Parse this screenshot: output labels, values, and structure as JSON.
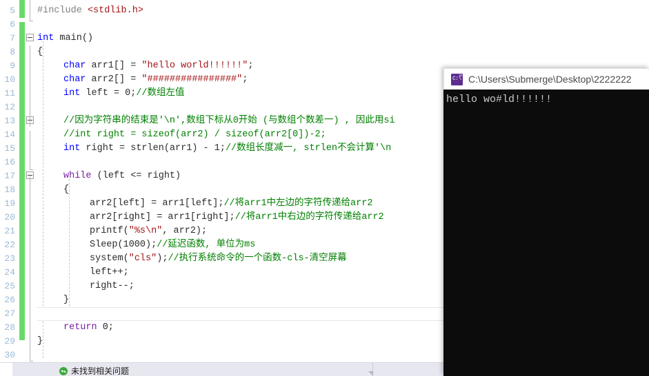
{
  "editor": {
    "first_visible_line_number": 5,
    "line_numbers": [
      5,
      6,
      7,
      8,
      9,
      10,
      11,
      12,
      13,
      14,
      15,
      16,
      17,
      18,
      19,
      20,
      21,
      22,
      23,
      24,
      25,
      26,
      27,
      28,
      29,
      30
    ],
    "lines": [
      {
        "n": 5,
        "indent": 0,
        "segments": [
          {
            "t": "#include ",
            "c": "ppd"
          },
          {
            "t": "<stdlib.h>",
            "c": "inc"
          }
        ]
      },
      {
        "n": 6,
        "indent": 0,
        "segments": []
      },
      {
        "n": 7,
        "indent": 0,
        "segments": [
          {
            "t": "int",
            "c": "kw"
          },
          {
            "t": " main()",
            "c": "pln"
          }
        ]
      },
      {
        "n": 8,
        "indent": 0,
        "segments": [
          {
            "t": "{",
            "c": "pln"
          }
        ]
      },
      {
        "n": 9,
        "indent": 1,
        "segments": [
          {
            "t": "char",
            "c": "kw"
          },
          {
            "t": " arr1[] = ",
            "c": "pln"
          },
          {
            "t": "\"hello world!!!!!!\"",
            "c": "str"
          },
          {
            "t": ";",
            "c": "pln"
          }
        ]
      },
      {
        "n": 10,
        "indent": 1,
        "segments": [
          {
            "t": "char",
            "c": "kw"
          },
          {
            "t": " arr2[] = ",
            "c": "pln"
          },
          {
            "t": "\"################\"",
            "c": "str"
          },
          {
            "t": ";",
            "c": "pln"
          }
        ]
      },
      {
        "n": 11,
        "indent": 1,
        "segments": [
          {
            "t": "int",
            "c": "kw"
          },
          {
            "t": " left = 0;",
            "c": "pln"
          },
          {
            "t": "//数组左值",
            "c": "cmt"
          }
        ]
      },
      {
        "n": 12,
        "indent": 1,
        "segments": []
      },
      {
        "n": 13,
        "indent": 1,
        "segments": [
          {
            "t": "//因为字符串的结束是'\\n',数组下标从0开始 (与数组个数差一) , 因此用si",
            "c": "cmt"
          }
        ]
      },
      {
        "n": 14,
        "indent": 1,
        "segments": [
          {
            "t": "//int right = sizeof(arr2) / sizeof(arr2[0])-2;",
            "c": "cmt"
          }
        ]
      },
      {
        "n": 15,
        "indent": 1,
        "segments": [
          {
            "t": "int",
            "c": "kw"
          },
          {
            "t": " right = strlen(arr1) - 1;",
            "c": "pln"
          },
          {
            "t": "//数组长度减一, strlen不会计算'\\n",
            "c": "cmt"
          }
        ]
      },
      {
        "n": 16,
        "indent": 1,
        "segments": []
      },
      {
        "n": 17,
        "indent": 1,
        "segments": [
          {
            "t": "while",
            "c": "kw2"
          },
          {
            "t": " (left <= right)",
            "c": "pln"
          }
        ]
      },
      {
        "n": 18,
        "indent": 1,
        "segments": [
          {
            "t": "{",
            "c": "pln"
          }
        ]
      },
      {
        "n": 19,
        "indent": 2,
        "segments": [
          {
            "t": "arr2[left] = arr1[left];",
            "c": "pln"
          },
          {
            "t": "//将arr1中左边的字符传递给arr2",
            "c": "cmt"
          }
        ]
      },
      {
        "n": 20,
        "indent": 2,
        "segments": [
          {
            "t": "arr2[right] = arr1[right];",
            "c": "pln"
          },
          {
            "t": "//将arr1中右边的字符传递给arr2",
            "c": "cmt"
          }
        ]
      },
      {
        "n": 21,
        "indent": 2,
        "segments": [
          {
            "t": "printf(",
            "c": "pln"
          },
          {
            "t": "\"%s\\n\"",
            "c": "str"
          },
          {
            "t": ", arr2);",
            "c": "pln"
          }
        ]
      },
      {
        "n": 22,
        "indent": 2,
        "segments": [
          {
            "t": "Sleep(1000);",
            "c": "pln"
          },
          {
            "t": "//延迟函数, 单位为ms",
            "c": "cmt"
          }
        ]
      },
      {
        "n": 23,
        "indent": 2,
        "segments": [
          {
            "t": "system(",
            "c": "pln"
          },
          {
            "t": "\"cls\"",
            "c": "str"
          },
          {
            "t": ");",
            "c": "pln"
          },
          {
            "t": "//执行系统命令的一个函数-cls-清空屏幕",
            "c": "cmt"
          }
        ]
      },
      {
        "n": 24,
        "indent": 2,
        "segments": [
          {
            "t": "left++;",
            "c": "pln"
          }
        ]
      },
      {
        "n": 25,
        "indent": 2,
        "segments": [
          {
            "t": "right--;",
            "c": "pln"
          }
        ]
      },
      {
        "n": 26,
        "indent": 1,
        "segments": [
          {
            "t": "}",
            "c": "pln"
          }
        ]
      },
      {
        "n": 27,
        "indent": 1,
        "segments": []
      },
      {
        "n": 28,
        "indent": 1,
        "segments": [
          {
            "t": "return",
            "c": "kw2"
          },
          {
            "t": " 0;",
            "c": "pln"
          }
        ]
      },
      {
        "n": 29,
        "indent": 0,
        "segments": [
          {
            "t": "}",
            "c": "pln"
          }
        ]
      },
      {
        "n": 30,
        "indent": 0,
        "segments": []
      }
    ],
    "cursor_line_number": 27,
    "colors": {
      "keyword": "#0000ff",
      "keyword_control": "#7a1fa2",
      "string": "#a31515",
      "comment": "#008000",
      "preprocessor": "#808080",
      "plain": "#2b2b2b",
      "line_number": "#9bb8d6",
      "change_bar": "#68d96a",
      "editor_background": "#ffffff"
    }
  },
  "statusbar": {
    "icon": "checkmark-circle-icon",
    "message": "未找到相关问题",
    "icon_color": "#3ca93c",
    "background": "#e7e7ef"
  },
  "console": {
    "icon": "command-prompt-icon",
    "icon_label": "C:\\",
    "title": "C:\\Users\\Submerge\\Desktop\\2222222",
    "output_lines": [
      "hello wo#ld!!!!!!"
    ],
    "background": "#0c0c0c",
    "text_color": "#cccccc",
    "titlebar_background": "#ffffff"
  }
}
